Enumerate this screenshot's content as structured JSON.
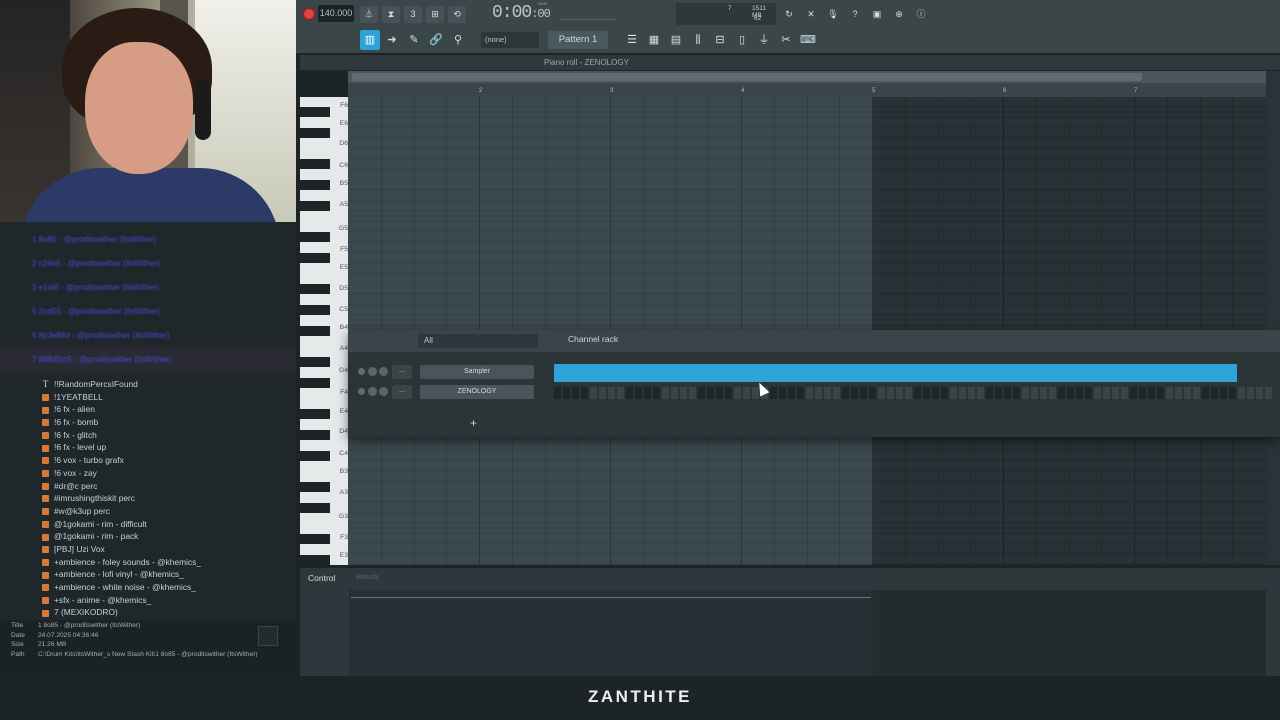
{
  "toolbar": {
    "tempo": "140.000",
    "time_display": "0:00",
    "time_small": ":00",
    "time_label": "M:S:CS",
    "cpu_voices": "7",
    "memory": "1511 MB",
    "cpu_percent": "62",
    "pattern_channel": "(none)",
    "pattern_name": "Pattern 1"
  },
  "browser": {
    "folders": [
      "1 8o85 - @proditswither (ItsWither)",
      "2 c24o5 - @proditswither (ItsWither)",
      "3 e1ra5 - @proditswither (ItsWither)",
      "5 2nd55 - @proditswither (ItsWither)",
      "6 8p3e88d - @proditswither (ItsWither)",
      "7 888d5tc5 - @proditswither (ItsWither)"
    ],
    "items": [
      {
        "icon": "text-icon",
        "label": "!!RandomPercsIFound"
      },
      {
        "icon": "folder-icon",
        "label": "!1YEATBELL"
      },
      {
        "icon": "folder-icon",
        "label": "!6 fx - alien"
      },
      {
        "icon": "folder-icon",
        "label": "!6 fx - bomb"
      },
      {
        "icon": "folder-icon",
        "label": "!6 fx - glitch"
      },
      {
        "icon": "folder-icon",
        "label": "!6 fx - level up"
      },
      {
        "icon": "folder-icon",
        "label": "!6 vox - turbo grafx"
      },
      {
        "icon": "folder-icon",
        "label": "!6 vox - zay"
      },
      {
        "icon": "folder-icon",
        "label": "#dr@c perc"
      },
      {
        "icon": "folder-icon",
        "label": "#imrushingthiskit perc"
      },
      {
        "icon": "folder-icon",
        "label": "#w@k3up perc"
      },
      {
        "icon": "folder-icon",
        "label": "@1gokami - rim - difficult"
      },
      {
        "icon": "folder-icon",
        "label": "@1gokami - rim - pack"
      },
      {
        "icon": "folder-icon",
        "label": "[PBJ] Uzi Vox"
      },
      {
        "icon": "folder-icon",
        "label": "+ambience - foley sounds - @khemics_"
      },
      {
        "icon": "folder-icon",
        "label": "+ambience - lofi vinyl - @khemics_"
      },
      {
        "icon": "folder-icon",
        "label": "+ambience - white noise - @khemics_"
      },
      {
        "icon": "folder-icon",
        "label": "+sfx - anime - @khemics_"
      },
      {
        "icon": "folder-icon",
        "label": "7 (MEXIKODRO)"
      }
    ],
    "info": {
      "title_key": "Title",
      "title": "1 8o85 - @proditswither (ItsWither)",
      "date_key": "Date",
      "date": "24.07.2025 04:36:46",
      "size_key": "Size",
      "size": "21.26 MB",
      "path_key": "Path",
      "path": "C:\\Drum Kits\\ItsWither_s New Stash Kit\\1 8o85 - @proditswither (ItsWither)"
    }
  },
  "piano_roll": {
    "title": "Piano roll - ZENOLOGY",
    "bars": [
      "2",
      "3",
      "4",
      "5",
      "6",
      "7"
    ],
    "keys_top": [
      "F6",
      "E6",
      "D6",
      "C6",
      "B5",
      "A5",
      "G5",
      "F5",
      "E5",
      "D5",
      "C5",
      "B4",
      "A4",
      "G4",
      "F4",
      "E4",
      "D4",
      "C4",
      "B3",
      "A3",
      "G3",
      "F3",
      "E3"
    ]
  },
  "channel_rack": {
    "filter": "All",
    "title": "Channel rack",
    "channels": [
      {
        "name": "Sampler",
        "num": "---"
      },
      {
        "name": "ZENOLOGY",
        "num": "---"
      }
    ],
    "add": "+"
  },
  "control": {
    "label": "Control",
    "sublabel": "Velocity"
  },
  "caption": "ZANTHITE",
  "colors": {
    "accent": "#2ea3d8",
    "record": "#e44040",
    "folder": "#d67a3a"
  }
}
